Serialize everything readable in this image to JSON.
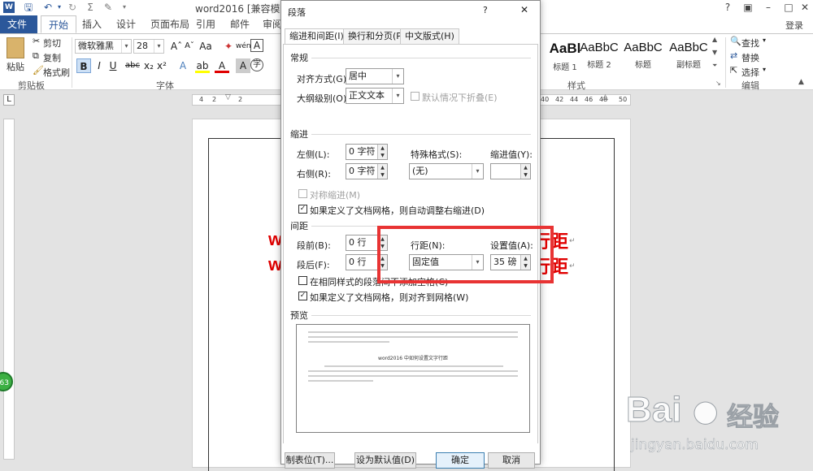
{
  "word": {
    "title": "word2016 [兼容模式] -",
    "login": "登录",
    "tabs": [
      "文件",
      "开始",
      "插入",
      "设计",
      "页面布局",
      "引用",
      "邮件",
      "审阅"
    ],
    "clipboard": {
      "paste": "粘贴",
      "cut": "剪切",
      "copy": "复制",
      "format_painter": "格式刷",
      "group": "剪贴板"
    },
    "font": {
      "name": "微软雅黑",
      "size": "28",
      "group": "字体"
    },
    "styles": {
      "items": [
        {
          "sample": "AaBl",
          "name": "标题 1"
        },
        {
          "sample": "AaBbC",
          "name": "标题 2"
        },
        {
          "sample": "AaBbC",
          "name": "标题"
        },
        {
          "sample": "AaBbC",
          "name": "副标题"
        }
      ],
      "group": "样式"
    },
    "editing": {
      "find": "查找",
      "replace": "替换",
      "select": "选择",
      "group": "编辑"
    },
    "ruler_left": [
      "4",
      "2",
      "",
      "2"
    ],
    "ruler_right": [
      "40",
      "42",
      "44",
      "46",
      "48",
      "",
      "50"
    ],
    "badge": "63",
    "doc_text_left": [
      "w",
      "w"
    ],
    "doc_text_right": [
      "行距",
      "行距"
    ]
  },
  "dialog": {
    "title": "段落",
    "help": "?",
    "tabs": [
      "缩进和间距(I)",
      "换行和分页(P)",
      "中文版式(H)"
    ],
    "general": {
      "section": "常规",
      "align_label": "对齐方式(G):",
      "align_value": "居中",
      "outline_label": "大纲级别(O):",
      "outline_value": "正文文本",
      "collapse_label": "默认情况下折叠(E)"
    },
    "indent": {
      "section": "缩进",
      "left_label": "左侧(L):",
      "left_value": "0 字符",
      "right_label": "右侧(R):",
      "right_value": "0 字符",
      "special_label": "特殊格式(S):",
      "special_value": "(无)",
      "by_label": "缩进值(Y):",
      "by_value": "",
      "mirror_label": "对称缩进(M)",
      "auto_adjust_label": "如果定义了文档网格，则自动调整右缩进(D)"
    },
    "spacing": {
      "section": "间距",
      "before_label": "段前(B):",
      "before_value": "0 行",
      "after_label": "段后(F):",
      "after_value": "0 行",
      "line_label": "行距(N):",
      "line_value": "固定值",
      "at_label": "设置值(A):",
      "at_value": "35 磅",
      "no_space_label": "在相同样式的段落间不添加空格(C)",
      "snap_grid_label": "如果定义了文档网格，则对齐到网格(W)"
    },
    "preview": {
      "section": "预览",
      "sample_text": "word2016 中如何设置文字行距"
    },
    "buttons": {
      "tabs": "制表位(T)...",
      "default": "设为默认值(D)",
      "ok": "确定",
      "cancel": "取消"
    }
  },
  "watermark": {
    "brand": "Bai",
    "brand2": "经验",
    "url": "jingyan.baidu.com"
  }
}
